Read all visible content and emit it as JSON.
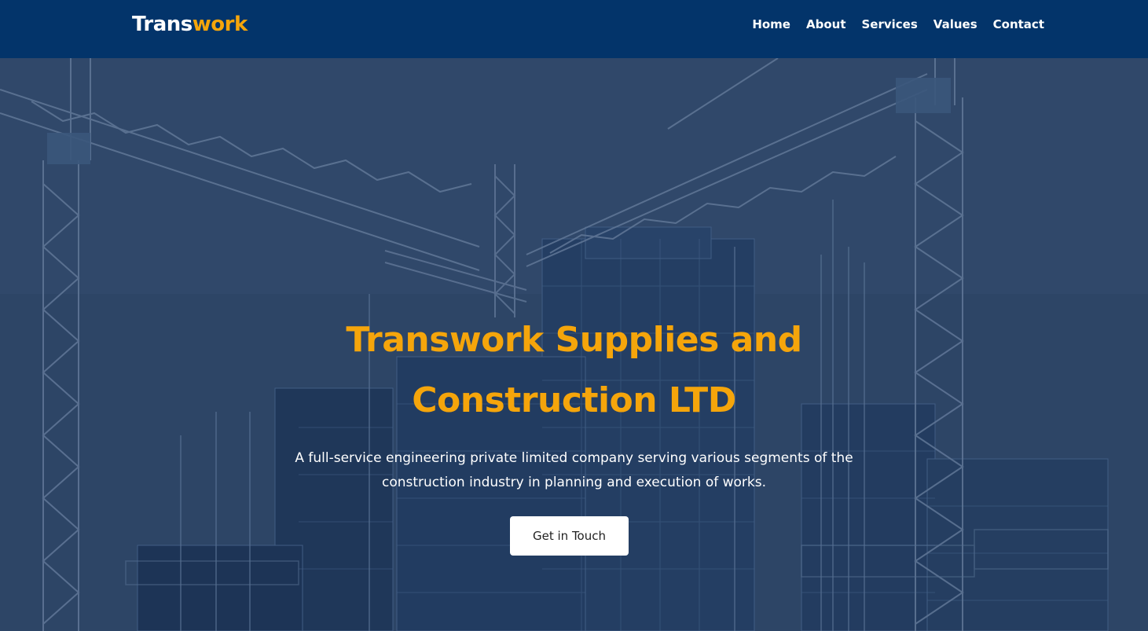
{
  "navbar": {
    "logo_primary": "Trans",
    "logo_accent": "work",
    "links": [
      "Home",
      "About",
      "Services",
      "Values",
      "Contact"
    ]
  },
  "hero": {
    "title_line1": "Transwork Supplies and",
    "title_line2": "Construction LTD",
    "subtitle": "A full-service engineering private limited company serving various segments of the construction industry in planning and execution of works.",
    "cta_label": "Get in Touch",
    "background_image": "construction-cranes-buildings"
  },
  "colors": {
    "nav_bg": "#03346a",
    "accent": "#f5a50b",
    "hero_overlay": "#1e3a66",
    "button_bg": "#ffffff"
  }
}
